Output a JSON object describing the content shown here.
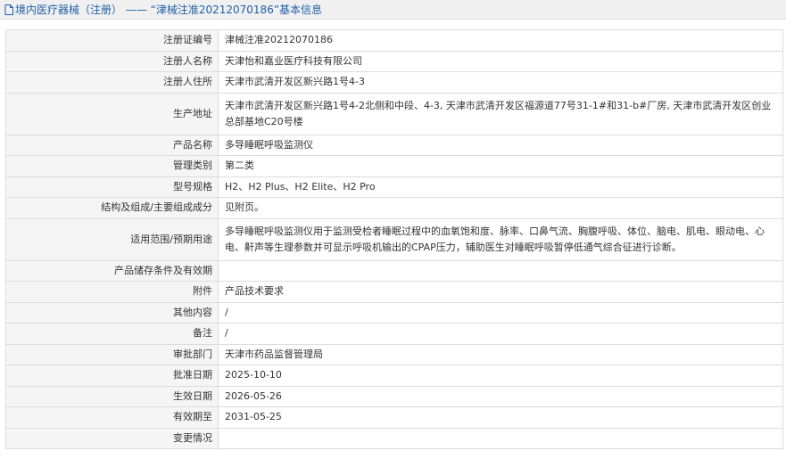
{
  "header": {
    "title": "境内医疗器械（注册） —— “津械注准20212070186”基本信息"
  },
  "rows": [
    {
      "label": "注册证编号",
      "value": "津械注准20212070186"
    },
    {
      "label": "注册人名称",
      "value": "天津怡和嘉业医疗科技有限公司"
    },
    {
      "label": "注册人住所",
      "value": "天津市武清开发区新兴路1号4-3"
    },
    {
      "label": "生产地址",
      "value": "天津市武清开发区新兴路1号4-2北侧和中段、4-3, 天津市武清开发区福源道77号31-1#和31-b#厂房, 天津市武清开发区创业总部基地C20号楼"
    },
    {
      "label": "产品名称",
      "value": "多导睡眠呼吸监测仪"
    },
    {
      "label": "管理类别",
      "value": "第二类"
    },
    {
      "label": "型号规格",
      "value": "H2、H2 Plus、H2 Elite、H2 Pro"
    },
    {
      "label": "结构及组成/主要组成成分",
      "value": "见附页。"
    },
    {
      "label": "适用范围/预期用途",
      "value": "多导睡眠呼吸监测仪用于监测受检者睡眠过程中的血氧饱和度、脉率、口鼻气流、胸腹呼吸、体位、脑电、肌电、眼动电、心电、鼾声等生理参数并可显示呼吸机输出的CPAP压力，辅助医生对睡眠呼吸暂停低通气综合征进行诊断。"
    },
    {
      "label": "产品储存条件及有效期",
      "value": ""
    },
    {
      "label": "附件",
      "value": "产品技术要求"
    },
    {
      "label": "其他内容",
      "value": "/"
    },
    {
      "label": "备注",
      "value": "/"
    },
    {
      "label": "审批部门",
      "value": "天津市药品监督管理局"
    },
    {
      "label": "批准日期",
      "value": "2025-10-10"
    },
    {
      "label": "生效日期",
      "value": "2026-05-26"
    },
    {
      "label": "有效期至",
      "value": "2031-05-25"
    },
    {
      "label": "变更情况",
      "value": ""
    }
  ]
}
